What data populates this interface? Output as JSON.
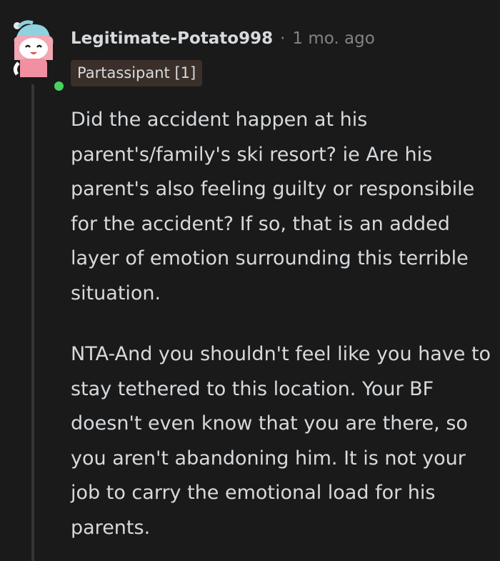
{
  "comment": {
    "author": "Legitimate-Potato998",
    "separator": "·",
    "time_ago": "1 mo. ago",
    "flair": "Partassipant [1]",
    "paragraphs": [
      "Did the accident happen at his parent's/family's ski resort? ie Are his parent's also feeling guilty or responsibile for the accident? If so, that is an added layer of emotion surrounding this terrible situation.",
      "NTA-And you shouldn't feel like you have to stay tethered to this location. Your BF doesn't even know that you are there, so you aren't abandoning him. It is not your job to carry the emotional load for his parents."
    ]
  },
  "colors": {
    "background": "#1a1a1b",
    "text": "#d7dadc",
    "meta_text": "#818384",
    "flair_background": "#3a3029",
    "online_indicator": "#46d160",
    "thread_line": "#343536"
  },
  "icons": {
    "avatar": "snoo-avatar-icon",
    "online": "online-status-icon"
  }
}
